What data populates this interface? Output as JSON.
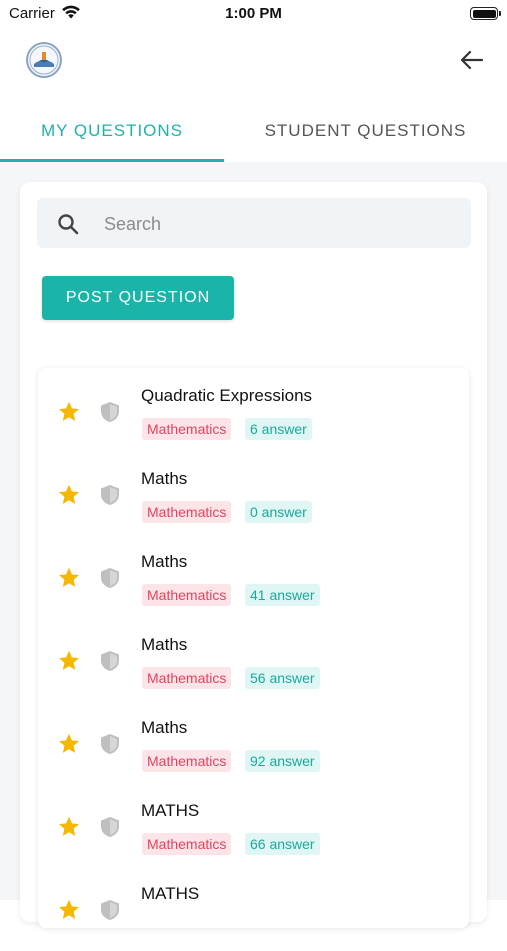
{
  "status_bar": {
    "carrier": "Carrier",
    "time": "1:00 PM"
  },
  "tabs": [
    {
      "label": "MY QUESTIONS",
      "active": true
    },
    {
      "label": "STUDENT QUESTIONS",
      "active": false
    }
  ],
  "search": {
    "placeholder": "Search",
    "value": ""
  },
  "post_button": {
    "label": "POST QUESTION"
  },
  "colors": {
    "accent": "#1ab5a8",
    "star": "#f5b800",
    "subject_tag": "#e0445e",
    "answer_tag": "#1aa99c"
  },
  "questions": [
    {
      "title": "Quadratic Expressions",
      "subject": "Mathematics",
      "answers": "6 answer"
    },
    {
      "title": "Maths",
      "subject": "Mathematics",
      "answers": "0 answer"
    },
    {
      "title": "Maths",
      "subject": "Mathematics",
      "answers": "41 answer"
    },
    {
      "title": "Maths",
      "subject": "Mathematics",
      "answers": "56 answer"
    },
    {
      "title": "Maths",
      "subject": "Mathematics",
      "answers": "92 answer"
    },
    {
      "title": "MATHS",
      "subject": "Mathematics",
      "answers": "66 answer"
    },
    {
      "title": "MATHS",
      "subject": "",
      "answers": ""
    }
  ]
}
